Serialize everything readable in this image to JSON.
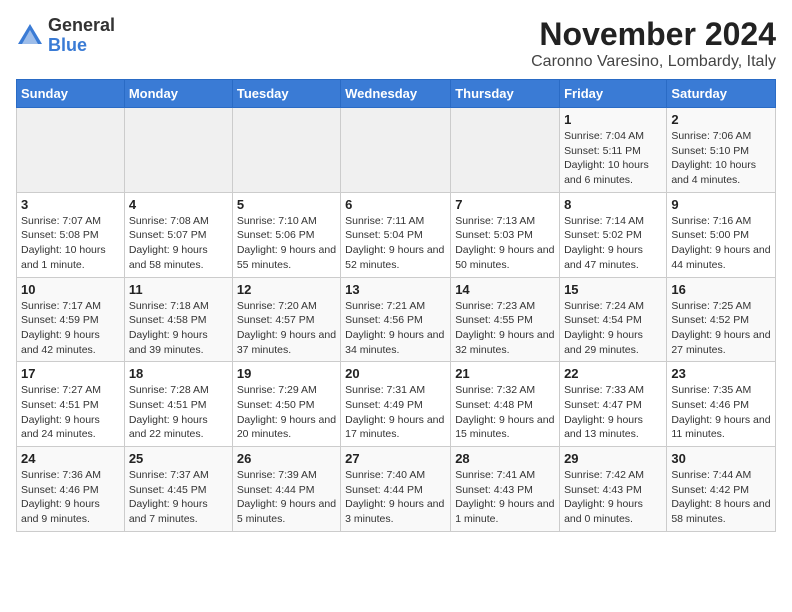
{
  "logo": {
    "general": "General",
    "blue": "Blue"
  },
  "title": {
    "month": "November 2024",
    "location": "Caronno Varesino, Lombardy, Italy"
  },
  "headers": [
    "Sunday",
    "Monday",
    "Tuesday",
    "Wednesday",
    "Thursday",
    "Friday",
    "Saturday"
  ],
  "weeks": [
    [
      {
        "day": "",
        "info": ""
      },
      {
        "day": "",
        "info": ""
      },
      {
        "day": "",
        "info": ""
      },
      {
        "day": "",
        "info": ""
      },
      {
        "day": "",
        "info": ""
      },
      {
        "day": "1",
        "info": "Sunrise: 7:04 AM\nSunset: 5:11 PM\nDaylight: 10 hours and 6 minutes."
      },
      {
        "day": "2",
        "info": "Sunrise: 7:06 AM\nSunset: 5:10 PM\nDaylight: 10 hours and 4 minutes."
      }
    ],
    [
      {
        "day": "3",
        "info": "Sunrise: 7:07 AM\nSunset: 5:08 PM\nDaylight: 10 hours and 1 minute."
      },
      {
        "day": "4",
        "info": "Sunrise: 7:08 AM\nSunset: 5:07 PM\nDaylight: 9 hours and 58 minutes."
      },
      {
        "day": "5",
        "info": "Sunrise: 7:10 AM\nSunset: 5:06 PM\nDaylight: 9 hours and 55 minutes."
      },
      {
        "day": "6",
        "info": "Sunrise: 7:11 AM\nSunset: 5:04 PM\nDaylight: 9 hours and 52 minutes."
      },
      {
        "day": "7",
        "info": "Sunrise: 7:13 AM\nSunset: 5:03 PM\nDaylight: 9 hours and 50 minutes."
      },
      {
        "day": "8",
        "info": "Sunrise: 7:14 AM\nSunset: 5:02 PM\nDaylight: 9 hours and 47 minutes."
      },
      {
        "day": "9",
        "info": "Sunrise: 7:16 AM\nSunset: 5:00 PM\nDaylight: 9 hours and 44 minutes."
      }
    ],
    [
      {
        "day": "10",
        "info": "Sunrise: 7:17 AM\nSunset: 4:59 PM\nDaylight: 9 hours and 42 minutes."
      },
      {
        "day": "11",
        "info": "Sunrise: 7:18 AM\nSunset: 4:58 PM\nDaylight: 9 hours and 39 minutes."
      },
      {
        "day": "12",
        "info": "Sunrise: 7:20 AM\nSunset: 4:57 PM\nDaylight: 9 hours and 37 minutes."
      },
      {
        "day": "13",
        "info": "Sunrise: 7:21 AM\nSunset: 4:56 PM\nDaylight: 9 hours and 34 minutes."
      },
      {
        "day": "14",
        "info": "Sunrise: 7:23 AM\nSunset: 4:55 PM\nDaylight: 9 hours and 32 minutes."
      },
      {
        "day": "15",
        "info": "Sunrise: 7:24 AM\nSunset: 4:54 PM\nDaylight: 9 hours and 29 minutes."
      },
      {
        "day": "16",
        "info": "Sunrise: 7:25 AM\nSunset: 4:52 PM\nDaylight: 9 hours and 27 minutes."
      }
    ],
    [
      {
        "day": "17",
        "info": "Sunrise: 7:27 AM\nSunset: 4:51 PM\nDaylight: 9 hours and 24 minutes."
      },
      {
        "day": "18",
        "info": "Sunrise: 7:28 AM\nSunset: 4:51 PM\nDaylight: 9 hours and 22 minutes."
      },
      {
        "day": "19",
        "info": "Sunrise: 7:29 AM\nSunset: 4:50 PM\nDaylight: 9 hours and 20 minutes."
      },
      {
        "day": "20",
        "info": "Sunrise: 7:31 AM\nSunset: 4:49 PM\nDaylight: 9 hours and 17 minutes."
      },
      {
        "day": "21",
        "info": "Sunrise: 7:32 AM\nSunset: 4:48 PM\nDaylight: 9 hours and 15 minutes."
      },
      {
        "day": "22",
        "info": "Sunrise: 7:33 AM\nSunset: 4:47 PM\nDaylight: 9 hours and 13 minutes."
      },
      {
        "day": "23",
        "info": "Sunrise: 7:35 AM\nSunset: 4:46 PM\nDaylight: 9 hours and 11 minutes."
      }
    ],
    [
      {
        "day": "24",
        "info": "Sunrise: 7:36 AM\nSunset: 4:46 PM\nDaylight: 9 hours and 9 minutes."
      },
      {
        "day": "25",
        "info": "Sunrise: 7:37 AM\nSunset: 4:45 PM\nDaylight: 9 hours and 7 minutes."
      },
      {
        "day": "26",
        "info": "Sunrise: 7:39 AM\nSunset: 4:44 PM\nDaylight: 9 hours and 5 minutes."
      },
      {
        "day": "27",
        "info": "Sunrise: 7:40 AM\nSunset: 4:44 PM\nDaylight: 9 hours and 3 minutes."
      },
      {
        "day": "28",
        "info": "Sunrise: 7:41 AM\nSunset: 4:43 PM\nDaylight: 9 hours and 1 minute."
      },
      {
        "day": "29",
        "info": "Sunrise: 7:42 AM\nSunset: 4:43 PM\nDaylight: 9 hours and 0 minutes."
      },
      {
        "day": "30",
        "info": "Sunrise: 7:44 AM\nSunset: 4:42 PM\nDaylight: 8 hours and 58 minutes."
      }
    ]
  ]
}
